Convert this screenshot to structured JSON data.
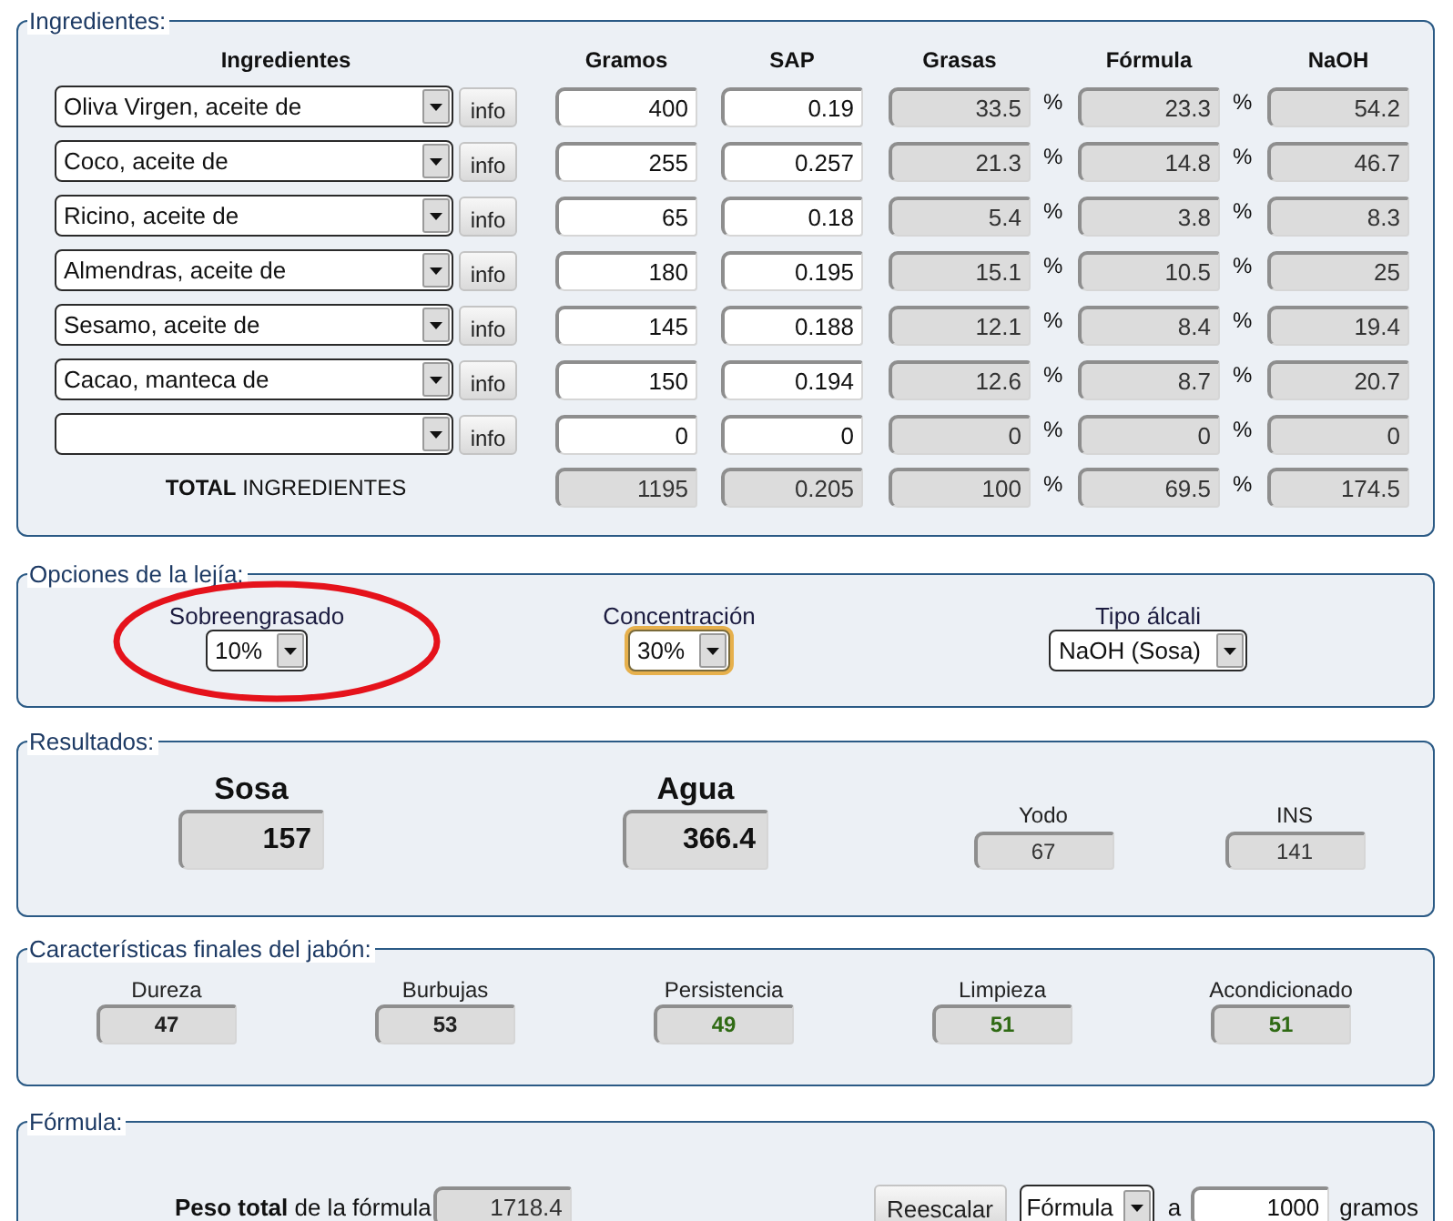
{
  "ingredients": {
    "legend": "Ingredientes:",
    "columns": [
      "Ingredientes",
      "Gramos",
      "SAP",
      "Grasas",
      "Fórmula",
      "NaOH"
    ],
    "rows": [
      {
        "ingredient": "Oliva Virgen, aceite de",
        "info": "info",
        "grams": "400",
        "sap": "0.19",
        "fats": "33.5",
        "fats_unit": "%",
        "formula": "23.3",
        "formula_unit": "%",
        "naoh": "54.2"
      },
      {
        "ingredient": "Coco, aceite de",
        "info": "info",
        "grams": "255",
        "sap": "0.257",
        "fats": "21.3",
        "fats_unit": "%",
        "formula": "14.8",
        "formula_unit": "%",
        "naoh": "46.7"
      },
      {
        "ingredient": "Ricino, aceite de",
        "info": "info",
        "grams": "65",
        "sap": "0.18",
        "fats": "5.4",
        "fats_unit": "%",
        "formula": "3.8",
        "formula_unit": "%",
        "naoh": "8.3"
      },
      {
        "ingredient": "Almendras, aceite de",
        "info": "info",
        "grams": "180",
        "sap": "0.195",
        "fats": "15.1",
        "fats_unit": "%",
        "formula": "10.5",
        "formula_unit": "%",
        "naoh": "25"
      },
      {
        "ingredient": "Sesamo, aceite de",
        "info": "info",
        "grams": "145",
        "sap": "0.188",
        "fats": "12.1",
        "fats_unit": "%",
        "formula": "8.4",
        "formula_unit": "%",
        "naoh": "19.4"
      },
      {
        "ingredient": "Cacao, manteca de",
        "info": "info",
        "grams": "150",
        "sap": "0.194",
        "fats": "12.6",
        "fats_unit": "%",
        "formula": "8.7",
        "formula_unit": "%",
        "naoh": "20.7"
      },
      {
        "info": "info",
        "grams": "0",
        "sap": "0",
        "fats": "0",
        "fats_unit": "%",
        "formula": "0",
        "formula_unit": "%",
        "naoh": "0"
      }
    ],
    "total": {
      "label": "**TOTAL** INGREDIENTES",
      "grams": "1195",
      "sap": "0.205",
      "fats": "100",
      "fats_unit": "%",
      "formula": "69.5",
      "formula_unit": "%",
      "naoh": "174.5"
    }
  },
  "lye_options": {
    "legend": "Opciones de la lejía:",
    "options": [
      {
        "label": "Sobreengrasado",
        "value": "10%",
        "focused": false,
        "highlighted": true
      },
      {
        "label": "Concentración",
        "value": "30%",
        "focused": true,
        "highlighted": false
      },
      {
        "label": "Tipo álcali",
        "value": "NaOH (Sosa)",
        "focused": false,
        "highlighted": false
      }
    ]
  },
  "results": {
    "legend": "Resultados:",
    "items": [
      {
        "kind": "main",
        "label": "Sosa",
        "value": "157"
      },
      {
        "kind": "main",
        "label": "Agua",
        "value": "366.4"
      },
      {
        "kind": "index",
        "label": "Yodo",
        "value": "67"
      },
      {
        "kind": "index",
        "label": "INS",
        "value": "141"
      }
    ]
  },
  "characteristics": {
    "legend": "Características finales del jabón:",
    "items": [
      {
        "label": "Dureza",
        "value": "47",
        "in_range": false
      },
      {
        "label": "Burbujas",
        "value": "53",
        "in_range": false
      },
      {
        "label": "Persistencia",
        "value": "49",
        "in_range": true
      },
      {
        "label": "Limpieza",
        "value": "51",
        "in_range": true
      },
      {
        "label": "Acondicionado",
        "value": "51",
        "in_range": true
      }
    ]
  },
  "formula": {
    "legend": "Fórmula:",
    "total_label": "**Peso total** de la fórmula",
    "total_value": "1718.4",
    "rescale_button": "Reescalar",
    "rescale_target": "Fórmula",
    "to_label": "a",
    "amount": "1000",
    "unit": "gramos"
  }
}
